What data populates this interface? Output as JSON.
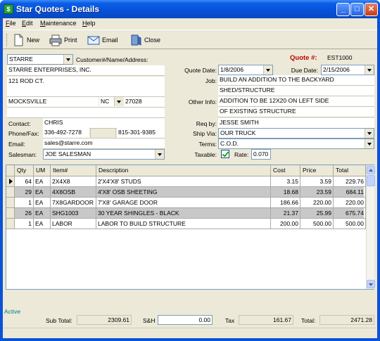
{
  "window": {
    "title": "Star Quotes - Details",
    "app_icon": "$"
  },
  "menu": [
    {
      "u": "F",
      "rest": "ile"
    },
    {
      "u": "E",
      "rest": "dit"
    },
    {
      "u": "M",
      "rest": "aintenance"
    },
    {
      "u": "H",
      "rest": "elp"
    }
  ],
  "toolbar": {
    "new_label": "New",
    "print_label": "Print",
    "email_label": "Email",
    "close_label": "Close"
  },
  "customer": {
    "code": "STARRE",
    "header_label": "Customer#/Name/Address:",
    "name": "STARRE ENTERPRISES, INC.",
    "address1": "121 ROD CT.",
    "address2": "",
    "city": "MOCKSVILLE",
    "state": "NC",
    "zip": "27028",
    "extra": "",
    "contact_label": "Contact:",
    "contact": "CHRIS",
    "phone_label": "Phone/Fax:",
    "phone": "336-492-7278",
    "phone_ext": "",
    "fax": "815-301-9385",
    "email_label": "Email:",
    "email": "sales@starre.com",
    "salesman_label": "Salesman:",
    "salesman": "JOE SALESMAN"
  },
  "quote": {
    "number_label": "Quote #:",
    "number": "EST1000",
    "date_label": "Quote Date:",
    "date": "1/8/2006",
    "due_label": "Due Date:",
    "due": "2/15/2006",
    "job_label": "Job:",
    "job1": "BUILD AN ADDITION TO THE BACKYARD",
    "job2": "SHED/STRUCTURE",
    "info_label": "Other Info:",
    "info1": "ADDITION TO BE 12X20 ON LEFT SIDE",
    "info2": "OF EXISTING STRUCTURE",
    "reqby_label": "Req by:",
    "reqby": "JESSE SMITH",
    "shipvia_label": "Ship Via:",
    "shipvia": "OUR TRUCK",
    "terms_label": "Terms:",
    "terms": "C.O.D.",
    "taxable_label": "Taxable:",
    "taxable": true,
    "rate_label": "Rate:",
    "rate": "0.070"
  },
  "grid": {
    "columns": [
      "Qty",
      "UM",
      "Item#",
      "Description",
      "Cost",
      "Price",
      "Total"
    ],
    "rows": [
      [
        "64",
        "EA",
        "2X4X8",
        "2'X4'X8' STUDS",
        "3.15",
        "3.59",
        "229.76"
      ],
      [
        "29",
        "EA",
        "4X8OSB",
        "4'X8' OSB SHEETING",
        "18.68",
        "23.59",
        "684.11"
      ],
      [
        "1",
        "EA",
        "7X8GARDOOR",
        "7'X8' GARAGE DOOR",
        "186.66",
        "220.00",
        "220.00"
      ],
      [
        "26",
        "EA",
        "SHG1003",
        "30 YEAR SHINGLES - BLACK",
        "21.37",
        "25.99",
        "675.74"
      ],
      [
        "1",
        "EA",
        "LABOR",
        "LABOR TO BUILD STRUCTURE",
        "200.00",
        "500.00",
        "500.00"
      ]
    ],
    "row_colors": [
      "#ffffff",
      "#c8c8c8"
    ]
  },
  "footer": {
    "status": "Active",
    "subtotal_label": "Sub Total:",
    "subtotal": "2309.61",
    "sh_label": "S&H",
    "sh": "0.00",
    "tax_label": "Tax",
    "tax": "161.67",
    "total_label": "Total:",
    "total": "2471.28"
  },
  "colors": {
    "title_bar": "#0b5ee8",
    "quote_label": "#c00000",
    "status": "#008080",
    "window_bg": "#ece9d8"
  }
}
